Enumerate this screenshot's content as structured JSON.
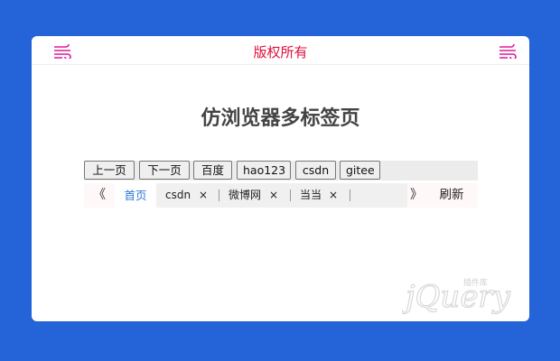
{
  "header": {
    "title": "版权所有",
    "left_icon": "wind-icon",
    "right_icon": "wind-icon",
    "icon_color": "#e0189a",
    "title_color": "#e0103a"
  },
  "page_title": "仿浏览器多标签页",
  "buttons": [
    "上一页",
    "下一页",
    "百度",
    "hao123",
    "csdn",
    "gitee"
  ],
  "tabbar": {
    "prev_arrow": "《",
    "next_arrow": "》",
    "refresh_label": "刷新",
    "home_tab": "首页",
    "tabs": [
      {
        "label": "csdn",
        "close": "×"
      },
      {
        "label": "微博网",
        "close": "×"
      },
      {
        "label": "当当",
        "close": "×"
      }
    ],
    "active_color": "#2a7bd8"
  },
  "watermark": {
    "text": "jQuery",
    "subtext": "插件库"
  },
  "colors": {
    "background": "#2463d8",
    "card": "#ffffff"
  }
}
